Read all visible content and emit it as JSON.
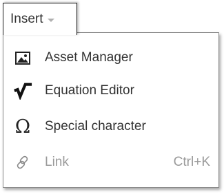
{
  "toolbar": {
    "insert_label": "Insert"
  },
  "menu": {
    "items": [
      {
        "label": "Asset Manager",
        "icon": "image-icon",
        "shortcut": "",
        "enabled": true
      },
      {
        "label": "Equation Editor",
        "icon": "square-root-icon",
        "shortcut": "",
        "enabled": true
      },
      {
        "label": "Special character",
        "icon": "omega-icon",
        "shortcut": "",
        "enabled": true
      },
      {
        "label": "Link",
        "icon": "link-icon",
        "shortcut": "Ctrl+K",
        "enabled": false
      }
    ]
  },
  "glyphs": {
    "omega": "Ω"
  },
  "colors": {
    "text": "#333333",
    "disabled_text": "#9a9a9a",
    "border": "#1a1a1a"
  }
}
